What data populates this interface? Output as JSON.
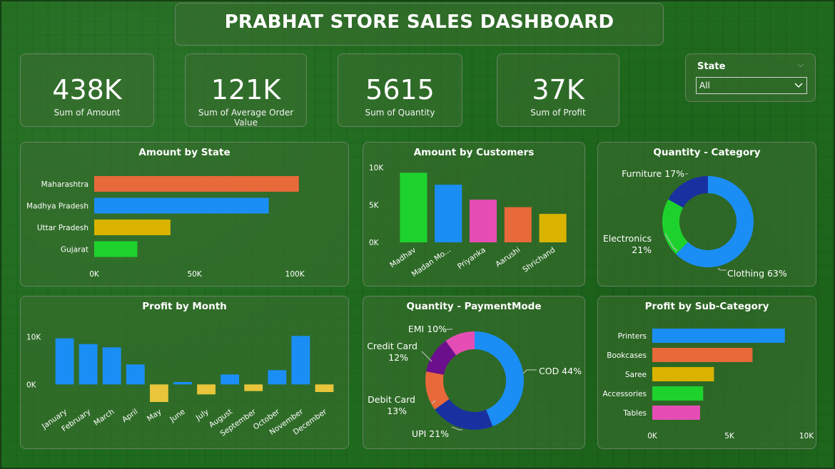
{
  "header": {
    "title": "PRABHAT STORE SALES DASHBOARD"
  },
  "kpis": [
    {
      "value": "438K",
      "label": "Sum of Amount"
    },
    {
      "value": "121K",
      "label": "Sum of Average Order Value"
    },
    {
      "value": "5615",
      "label": "Sum of Quantity"
    },
    {
      "value": "37K",
      "label": "Sum of Profit"
    }
  ],
  "slicer": {
    "title": "State",
    "selected": "All"
  },
  "colors": {
    "orange": "#E8693A",
    "blue": "#1B8EF6",
    "gold": "#D9B300",
    "green": "#1ED22E",
    "pink": "#E54DB5",
    "navy": "#1931A0",
    "purple": "#6B0F8C",
    "yellow": "#E8C53A"
  },
  "charts": [
    {
      "id": "amount-by-state",
      "title": "Amount by State",
      "type": "bar",
      "categories": [
        "Maharashtra",
        "Madhya Pradesh",
        "Uttar Pradesh",
        "Gujarat"
      ],
      "values": [
        102000,
        87000,
        38000,
        21500
      ],
      "colors": [
        "#E8693A",
        "#1B8EF6",
        "#D9B300",
        "#1ED22E"
      ],
      "xlim": [
        0,
        106000
      ],
      "xticks": [
        0,
        50000,
        100000
      ],
      "xtick_labels": [
        "0K",
        "50K",
        "100K"
      ]
    },
    {
      "id": "amount-by-customers",
      "title": "Amount by Customers",
      "type": "bar",
      "categories": [
        "Madhav",
        "Madan Mo...",
        "Priyanka",
        "Aarushi",
        "Shrichand"
      ],
      "values": [
        9300,
        7700,
        5700,
        4700,
        3800
      ],
      "colors": [
        "#1ED22E",
        "#1B8EF6",
        "#E54DB5",
        "#E8693A",
        "#D9B300"
      ],
      "ylim": [
        0,
        10000
      ],
      "yticks": [
        0,
        5000,
        10000
      ],
      "ytick_labels": [
        "0K",
        "5K",
        "10K"
      ]
    },
    {
      "id": "quantity-category",
      "title": "Quantity - Category",
      "type": "pie",
      "slices": [
        {
          "label": "Clothing",
          "pct": "63%",
          "value": 63,
          "color": "#1B8EF6"
        },
        {
          "label": "Electronics",
          "pct": "21%",
          "value": 21,
          "color": "#1ED22E"
        },
        {
          "label": "Furniture",
          "pct": "17%",
          "value": 17,
          "color": "#1931A0"
        }
      ]
    },
    {
      "id": "profit-by-month",
      "title": "Profit by Month",
      "type": "bar",
      "categories": [
        "January",
        "February",
        "March",
        "April",
        "May",
        "June",
        "July",
        "August",
        "September",
        "October",
        "November",
        "December"
      ],
      "values": [
        9700,
        8500,
        7800,
        4200,
        -3700,
        500,
        -2100,
        2100,
        -1400,
        3000,
        10200,
        -1600
      ],
      "ylim": [
        -4000,
        11000
      ],
      "yticks": [
        0,
        10000
      ],
      "ytick_labels": [
        "0K",
        "10K"
      ]
    },
    {
      "id": "quantity-paymentmode",
      "title": "Quantity - PaymentMode",
      "type": "pie",
      "slices": [
        {
          "label": "COD",
          "pct": "44%",
          "value": 44,
          "color": "#1B8EF6"
        },
        {
          "label": "UPI",
          "pct": "21%",
          "value": 21,
          "color": "#1931A0"
        },
        {
          "label": "Debit Card",
          "pct": "13%",
          "value": 13,
          "color": "#E8693A"
        },
        {
          "label": "Credit Card",
          "pct": "12%",
          "value": 12,
          "color": "#6B0F8C"
        },
        {
          "label": "EMI",
          "pct": "10%",
          "value": 10,
          "color": "#E54DB5"
        }
      ]
    },
    {
      "id": "profit-by-sub-category",
      "title": "Profit by Sub-Category",
      "type": "bar",
      "categories": [
        "Printers",
        "Bookcases",
        "Saree",
        "Accessories",
        "Tables"
      ],
      "values": [
        8600,
        6500,
        4000,
        3300,
        3100
      ],
      "colors": [
        "#1B8EF6",
        "#E8693A",
        "#D9B300",
        "#1ED22E",
        "#E54DB5"
      ],
      "xlim": [
        0,
        10000
      ],
      "xticks": [
        0,
        5000,
        10000
      ],
      "xtick_labels": [
        "0K",
        "5K",
        "10K"
      ]
    }
  ]
}
